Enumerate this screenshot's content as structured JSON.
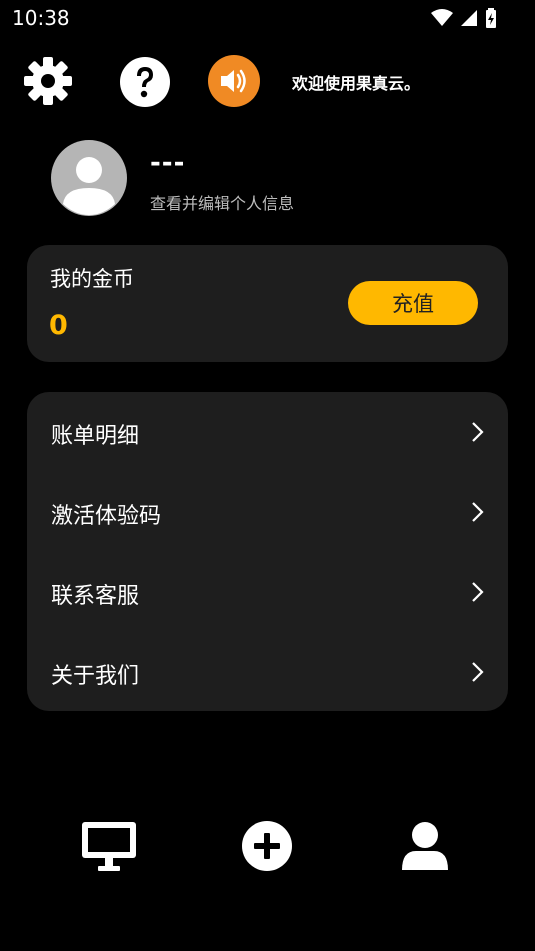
{
  "status": {
    "time": "10:38"
  },
  "header": {
    "icons": [
      "gear-icon",
      "help-icon",
      "speaker-icon"
    ],
    "notice": "欢迎使用果真云。",
    "accent": "#f08a24"
  },
  "profile": {
    "nickname": "---",
    "edit_hint": "查看并编辑个人信息"
  },
  "coins": {
    "label": "我的金币",
    "value": "0",
    "recharge_label": "充值",
    "accent": "#ffb800"
  },
  "menu": {
    "items": [
      {
        "label": "账单明细"
      },
      {
        "label": "激活体验码"
      },
      {
        "label": "联系客服"
      },
      {
        "label": "关于我们"
      }
    ]
  },
  "tabbar": {
    "items": [
      "monitor-icon",
      "add-icon",
      "user-icon"
    ]
  }
}
